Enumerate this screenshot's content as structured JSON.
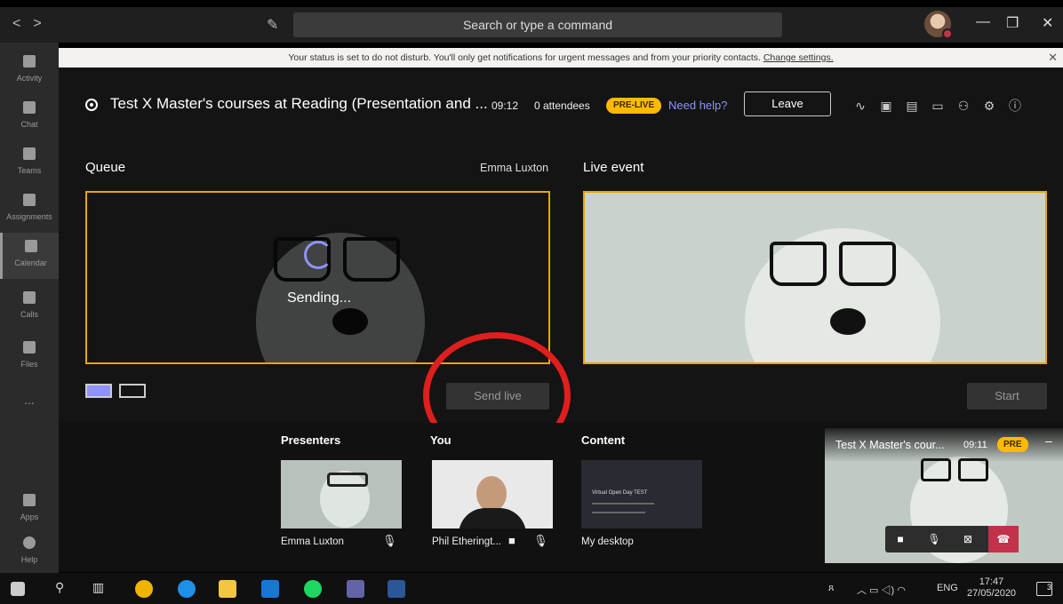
{
  "titlebar": {
    "back": "<",
    "forward": ">",
    "search_placeholder": "Search or type a command",
    "minimize": "—",
    "maximize": "❐",
    "close": "✕"
  },
  "rail": [
    {
      "label": "Activity",
      "icon": "bell-icon"
    },
    {
      "label": "Chat",
      "icon": "chat-icon"
    },
    {
      "label": "Teams",
      "icon": "teams-icon"
    },
    {
      "label": "Assignments",
      "icon": "assignments-icon"
    },
    {
      "label": "Calendar",
      "icon": "calendar-icon",
      "active": true
    },
    {
      "label": "Calls",
      "icon": "phone-icon"
    },
    {
      "label": "Files",
      "icon": "files-icon"
    },
    {
      "label": "...",
      "icon": "more-icon"
    },
    {
      "label": "Apps",
      "icon": "apps-icon"
    },
    {
      "label": "Help",
      "icon": "help-icon"
    }
  ],
  "notice": {
    "text": "Your status is set to do not disturb. You'll only get notifications for urgent messages and from your priority contacts.",
    "link": "Change settings."
  },
  "event": {
    "title": "Test X Master's courses at Reading (Presentation and ...",
    "time": "09:12",
    "attendees": "0 attendees",
    "badge": "PRE-LIVE",
    "help": "Need help?",
    "leave": "Leave"
  },
  "queue": {
    "label": "Queue",
    "presenter": "Emma Luxton",
    "status": "Sending...",
    "send_live": "Send live"
  },
  "live": {
    "label": "Live event",
    "start": "Start"
  },
  "bottom": {
    "presenters_label": "Presenters",
    "you_label": "You",
    "content_label": "Content",
    "presenter_name": "Emma Luxton",
    "you_name": "Phil Etheringt...",
    "content_name": "My desktop",
    "content_slide": "Virtual Open Day TEST"
  },
  "pip": {
    "title": "Test X Master's cour...",
    "time": "09:11",
    "badge": "PRE"
  },
  "taskbar": {
    "lang": "ENG",
    "time": "17:47",
    "date": "27/05/2020",
    "notif_count": "3"
  },
  "colors": {
    "accent": "#8f93ff",
    "badge": "#ffb900",
    "frame": "#e6a800",
    "hangup": "#c4314b",
    "annotation": "#e01e1e"
  }
}
